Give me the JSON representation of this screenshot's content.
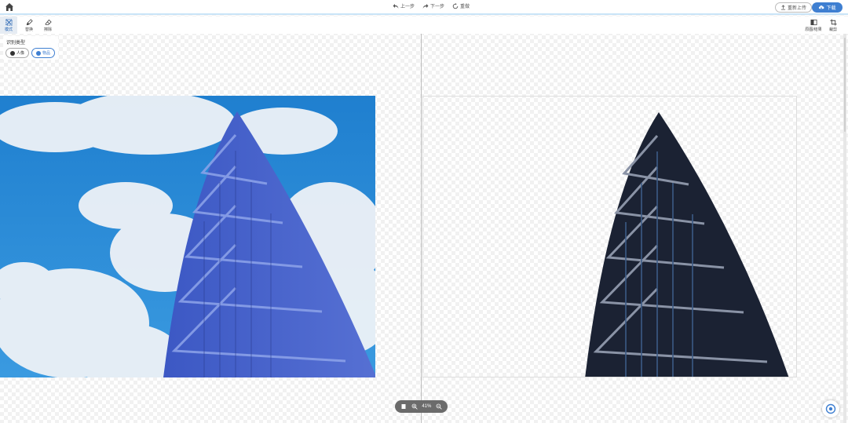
{
  "topbar": {
    "home_icon": "home-icon",
    "undo_label": "上一步",
    "redo_label": "下一步",
    "reset_label": "重做",
    "reupload_label": "重新上传",
    "download_label": "下载"
  },
  "toolbar": {
    "tools": [
      {
        "label": "模式",
        "icon": "cutout-icon",
        "active": true
      },
      {
        "label": "替换",
        "icon": "brush-icon"
      },
      {
        "label": "擦除",
        "icon": "eraser-icon"
      }
    ],
    "right_tools": [
      {
        "label": "原图/结果",
        "icon": "compare-icon"
      },
      {
        "label": "裁剪",
        "icon": "crop-icon"
      }
    ]
  },
  "mode_panel": {
    "title": "识别类型",
    "options": [
      {
        "label": "人像",
        "selected": false
      },
      {
        "label": "物品",
        "selected": true
      }
    ]
  },
  "zoom": {
    "level": "41%"
  },
  "colors": {
    "accent": "#3f7fd1",
    "sky": "#2a86d0",
    "building_tint": "#3d5fcb",
    "building_dark": "#1b2233"
  }
}
